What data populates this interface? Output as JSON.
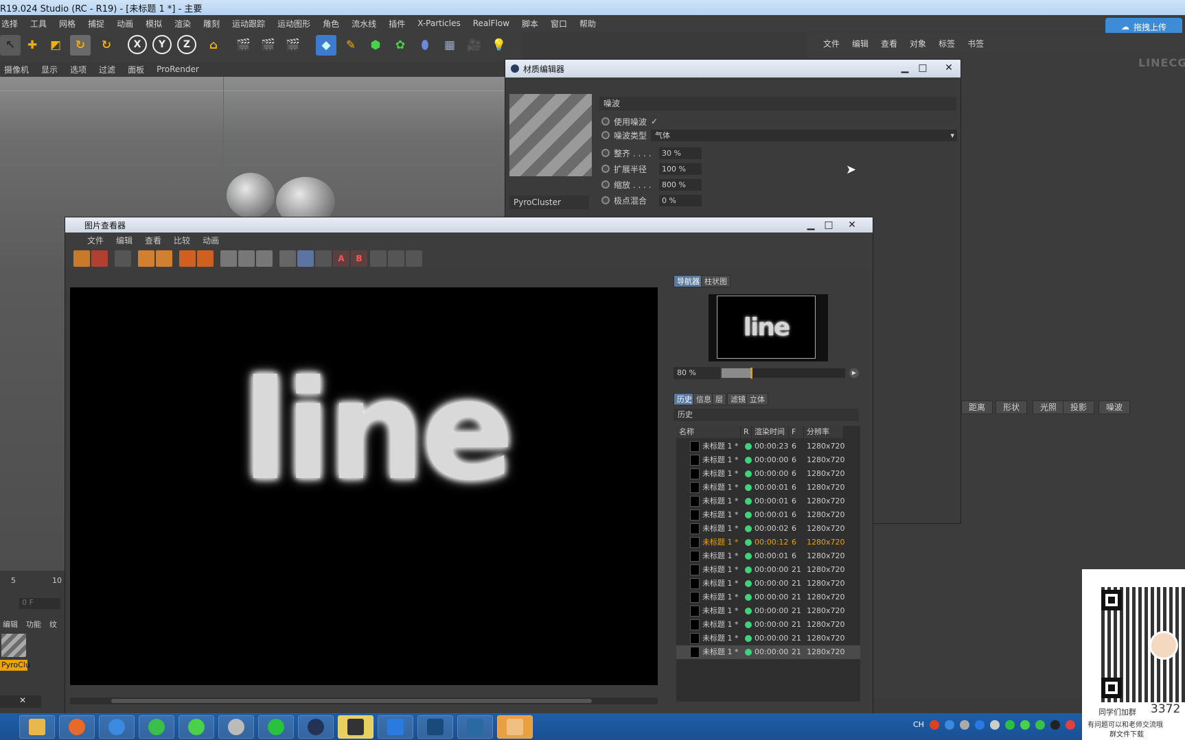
{
  "app": {
    "title": "R19.024 Studio (RC - R19) - [未标题 1 *] - 主要",
    "upload_label": "拖拽上传",
    "watermark": "LINECG"
  },
  "main_menu": [
    "选择",
    "工具",
    "网格",
    "捕捉",
    "动画",
    "模拟",
    "渲染",
    "雕刻",
    "运动跟踪",
    "运动图形",
    "角色",
    "流水线",
    "插件",
    "X-Particles",
    "RealFlow",
    "脚本",
    "窗口",
    "帮助"
  ],
  "view_menu": [
    "摄像机",
    "显示",
    "选项",
    "过滤",
    "面板",
    "ProRender"
  ],
  "right_menu": [
    "文件",
    "编辑",
    "查看",
    "对象",
    "标签",
    "书签"
  ],
  "right_tabs": [
    "距离",
    "形状",
    "光照",
    "投影",
    "噪波"
  ],
  "material_editor": {
    "title": "材质编辑器",
    "material_name": "PyroCluster",
    "section": "噪波",
    "use_noise_label": "使用噪波",
    "use_noise_checked": true,
    "noise_type_label": "噪波类型",
    "noise_type_value": "气体",
    "params": [
      {
        "label": "整齐 . . . .",
        "value": "30 %"
      },
      {
        "label": "扩展半径",
        "value": "100 %"
      },
      {
        "label": "缩放 . . . .",
        "value": "800 %"
      },
      {
        "label": "极点混合",
        "value": "0 %"
      }
    ]
  },
  "picture_viewer": {
    "title": "图片查看器",
    "menu": [
      "文件",
      "编辑",
      "查看",
      "比较",
      "动画"
    ],
    "render_text": "line",
    "side_tabs": [
      "导航器",
      "柱状图"
    ],
    "zoom": "80 %",
    "zoom_fraction": 0.24,
    "info_tabs": [
      "历史",
      "信息",
      "层",
      "滤镜",
      "立体"
    ],
    "history_label": "历史",
    "columns": [
      "名称",
      "R",
      "渲染时间",
      "F",
      "分辨率"
    ],
    "history": [
      {
        "name": "未标题 1 *",
        "time": "00:00:23",
        "f": "6",
        "res": "1280x720"
      },
      {
        "name": "未标题 1 *",
        "time": "00:00:00",
        "f": "6",
        "res": "1280x720"
      },
      {
        "name": "未标题 1 *",
        "time": "00:00:00",
        "f": "6",
        "res": "1280x720"
      },
      {
        "name": "未标题 1 *",
        "time": "00:00:01",
        "f": "6",
        "res": "1280x720"
      },
      {
        "name": "未标题 1 *",
        "time": "00:00:01",
        "f": "6",
        "res": "1280x720"
      },
      {
        "name": "未标题 1 *",
        "time": "00:00:01",
        "f": "6",
        "res": "1280x720"
      },
      {
        "name": "未标题 1 *",
        "time": "00:00:02",
        "f": "6",
        "res": "1280x720"
      },
      {
        "name": "未标题 1 *",
        "time": "00:00:12",
        "f": "6",
        "res": "1280x720",
        "highlight": true
      },
      {
        "name": "未标题 1 *",
        "time": "00:00:01",
        "f": "6",
        "res": "1280x720"
      },
      {
        "name": "未标题 1 *",
        "time": "00:00:00",
        "f": "21",
        "res": "1280x720"
      },
      {
        "name": "未标题 1 *",
        "time": "00:00:00",
        "f": "21",
        "res": "1280x720"
      },
      {
        "name": "未标题 1 *",
        "time": "00:00:00",
        "f": "21",
        "res": "1280x720"
      },
      {
        "name": "未标题 1 *",
        "time": "00:00:00",
        "f": "21",
        "res": "1280x720"
      },
      {
        "name": "未标题 1 *",
        "time": "00:00:00",
        "f": "21",
        "res": "1280x720"
      },
      {
        "name": "未标题 1 *",
        "time": "00:00:00",
        "f": "21",
        "res": "1280x720"
      },
      {
        "name": "未标题 1 *",
        "time": "00:00:00",
        "f": "21",
        "res": "1280x720",
        "selected": true
      }
    ]
  },
  "timeline": {
    "tick5": "5",
    "tick10": "10",
    "frame": "0 F"
  },
  "material_manager": {
    "menu": [
      "编辑",
      "功能",
      "纹"
    ],
    "item": "PyroClu"
  },
  "qr": {
    "line1": "同学们加群",
    "number": "3372",
    "line2": "有问题可以和老师交流哦",
    "line3": "群文件下载"
  },
  "tray": {
    "lang": "CH"
  }
}
